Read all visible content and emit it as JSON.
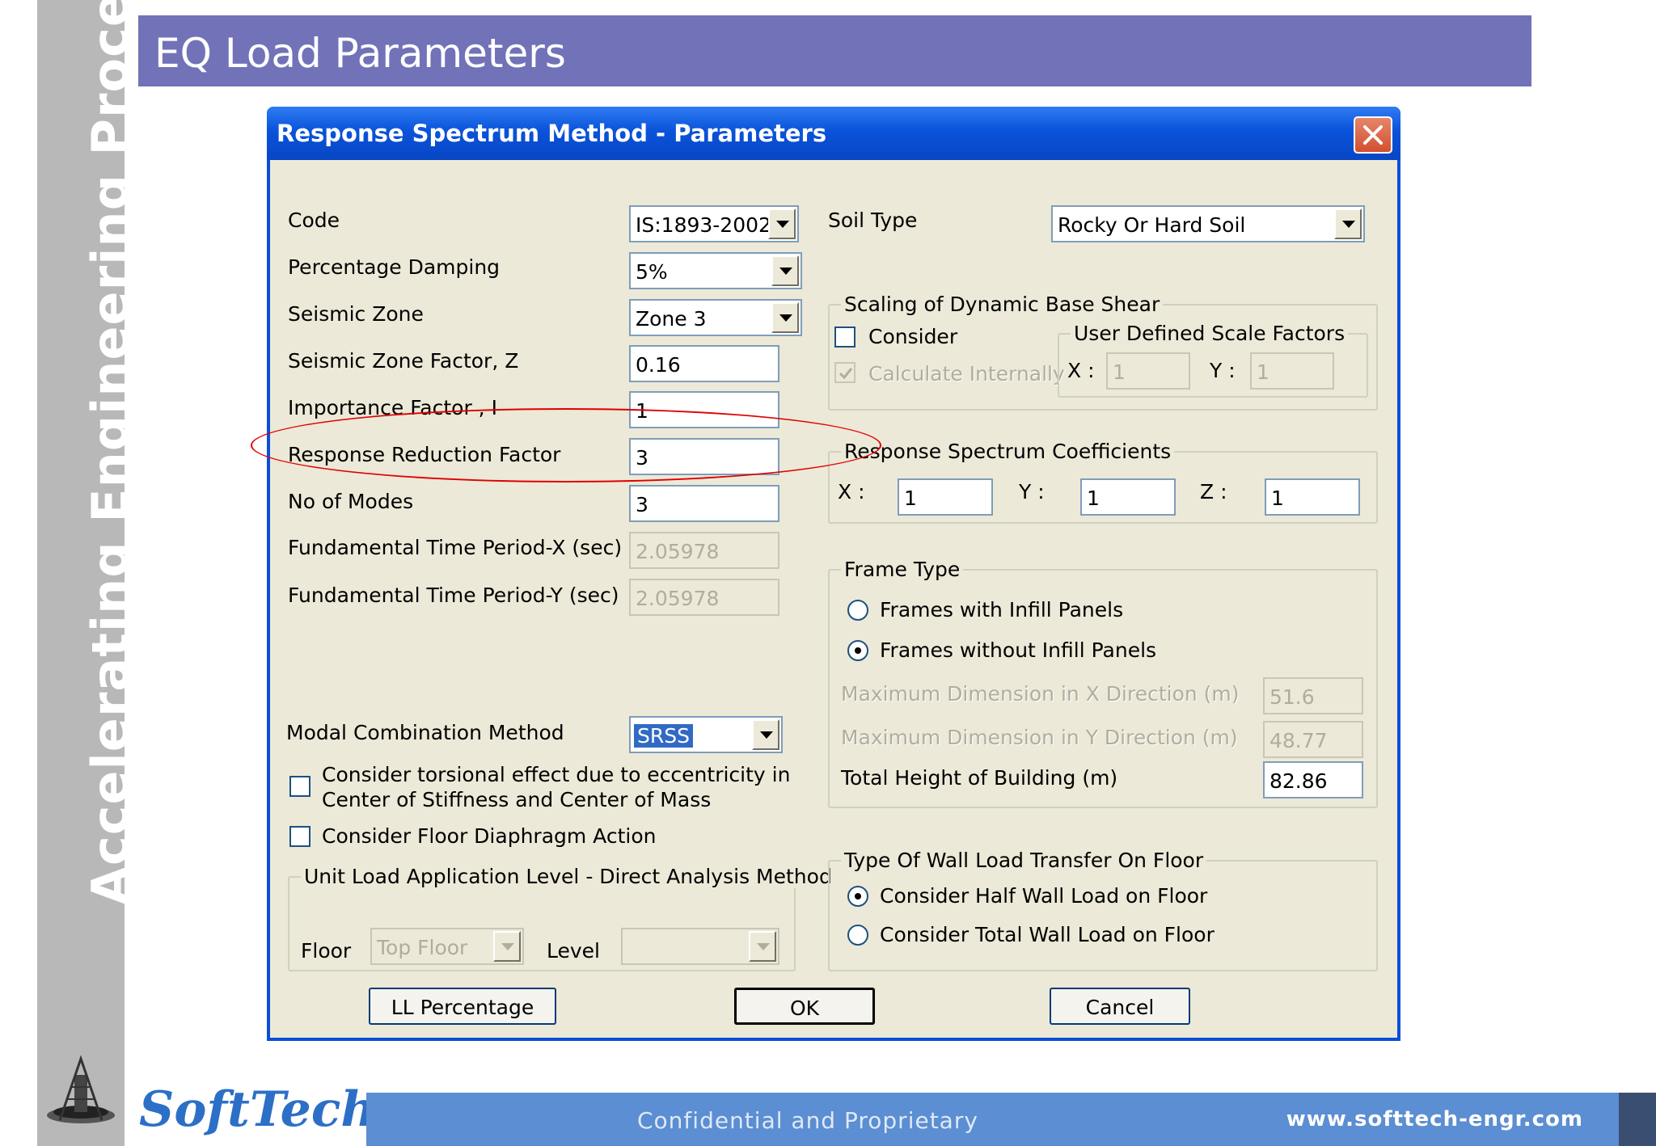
{
  "slide": {
    "header_title": "EQ Load Parameters",
    "sidebar_text": "Accelerating Engineering Processes",
    "footer_logo": "SoftTech",
    "footer_center": "Confidential  and Proprietary",
    "footer_url": "www.softtech-engr.com"
  },
  "dialog": {
    "title": "Response Spectrum Method - Parameters",
    "left": {
      "code_label": "Code",
      "code_value": "IS:1893-2002",
      "damping_label": "Percentage Damping",
      "damping_value": "5%",
      "zone_label": "Seismic Zone",
      "zone_value": "Zone 3",
      "zone_factor_label": "Seismic Zone Factor, Z",
      "zone_factor_value": "0.16",
      "importance_label": "Importance Factor , I",
      "importance_value": "1",
      "reduction_label": "Response Reduction Factor",
      "reduction_value": "3",
      "modes_label": "No of Modes",
      "modes_value": "3",
      "period_x_label": "Fundamental Time Period-X (sec)",
      "period_x_value": "2.05978",
      "period_y_label": "Fundamental Time Period-Y (sec)",
      "period_y_value": "2.05978",
      "modal_label": "Modal Combination Method",
      "modal_value": "SRSS",
      "torsion_label_1": "Consider torsional effect due to eccentricity in",
      "torsion_label_2": "Center of Stiffness and Center of Mass",
      "diaphragm_label": "Consider Floor Diaphragm Action",
      "unit_load_title": "Unit Load Application Level - Direct Analysis Method",
      "floor_label": "Floor",
      "floor_value": "Top Floor",
      "level_label": "Level",
      "level_value": ""
    },
    "right": {
      "soil_label": "Soil Type",
      "soil_value": "Rocky Or Hard Soil",
      "scaling_title": "Scaling of Dynamic Base Shear",
      "consider_label": "Consider",
      "calc_label": "Calculate Internally",
      "user_scale_title": "User Defined Scale Factors",
      "scale_x_label": "X :",
      "scale_x_value": "1",
      "scale_y_label": "Y :",
      "scale_y_value": "1",
      "coeff_title": "Response Spectrum Coefficients",
      "coeff_x_label": "X :",
      "coeff_x_value": "1",
      "coeff_y_label": "Y :",
      "coeff_y_value": "1",
      "coeff_z_label": "Z :",
      "coeff_z_value": "1",
      "frame_title": "Frame Type",
      "frame_opt1": "Frames with Infill Panels",
      "frame_opt2": "Frames without Infill Panels",
      "max_x_label": "Maximum Dimension in X Direction  (m)",
      "max_x_value": "51.6",
      "max_y_label": "Maximum Dimension in Y Direction  (m)",
      "max_y_value": "48.77",
      "height_label": "Total Height of Building  (m)",
      "height_value": "82.86",
      "wall_title": "Type Of Wall Load Transfer On Floor",
      "wall_opt1": "Consider Half Wall  Load on Floor",
      "wall_opt2": "Consider Total  Wall  Load on Floor"
    },
    "buttons": {
      "ll": "LL Percentage",
      "ok": "OK",
      "cancel": "Cancel"
    }
  },
  "colors": {
    "header": "#7272b8",
    "titlebar": "#0a53db",
    "dialog_bg": "#ece9d8",
    "highlight_ellipse": "#e00000",
    "footer": "#5b8ed2"
  }
}
